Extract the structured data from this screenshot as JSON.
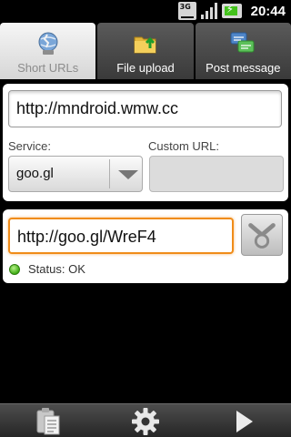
{
  "status_bar": {
    "network": "3G",
    "time": "20:44"
  },
  "tabs": [
    {
      "label": "Short URLs",
      "icon": "globe-pin-icon",
      "active": true
    },
    {
      "label": "File upload",
      "icon": "folder-upload-icon",
      "active": false
    },
    {
      "label": "Post message",
      "icon": "chat-messages-icon",
      "active": false
    }
  ],
  "shorten_form": {
    "long_url_value": "http://mndroid.wmw.cc",
    "service_label": "Service:",
    "service_selected": "goo.gl",
    "custom_url_label": "Custom URL:",
    "custom_url_value": ""
  },
  "result": {
    "short_url_value": "http://goo.gl/WreF4",
    "share_icon": "share-icon",
    "status_text": "Status: OK",
    "status_color": "#3fae14"
  },
  "bottom_bar": {
    "items": [
      "clipboard-icon",
      "gear-icon",
      "play-icon"
    ]
  },
  "colors": {
    "focus_orange": "#f08c19",
    "active_tab_bg": "#e8e8e8",
    "inactive_tab_bg": "#4a4a4a"
  }
}
